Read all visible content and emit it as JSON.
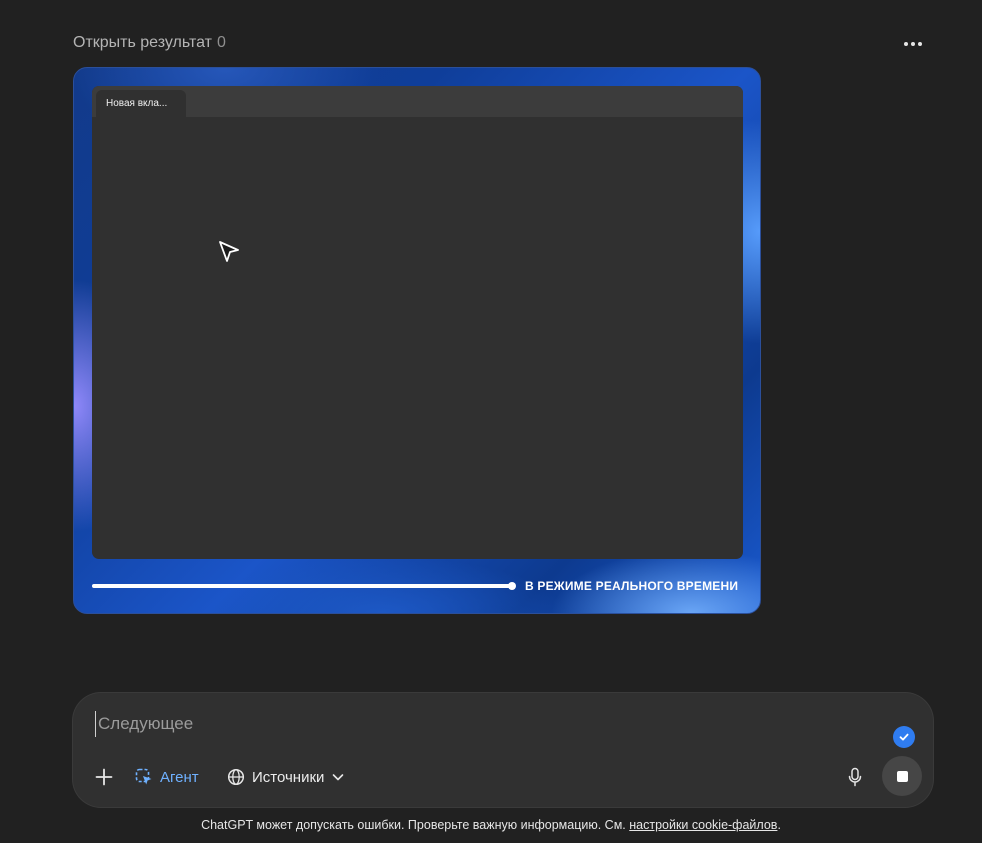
{
  "header": {
    "title": "Открыть результат",
    "count": "0",
    "more_icon": "more-horizontal-icon"
  },
  "preview": {
    "tab_label": "Новая вкла...",
    "live_label": "В РЕЖИМЕ РЕАЛЬНОГО ВРЕМЕНИ",
    "cursor_icon": "cursor-arrow-icon",
    "progress": 1.0
  },
  "composer": {
    "placeholder": "Следующее",
    "value": "",
    "agent_label": "Агент",
    "sources_label": "Источники",
    "plus_icon": "plus-icon",
    "agent_icon": "agent-cursor-icon",
    "globe_icon": "globe-icon",
    "chevron_icon": "chevron-down-icon",
    "mic_icon": "microphone-icon",
    "stop_icon": "stop-icon",
    "check_icon": "check-icon",
    "accent_color": "#6fb1ff",
    "badge_color": "#2f7cf0"
  },
  "footer": {
    "disclaimer_text": "ChatGPT может допускать ошибки. Проверьте важную информацию. См. ",
    "link_text": "настройки cookie-файлов",
    "end_text": "."
  }
}
